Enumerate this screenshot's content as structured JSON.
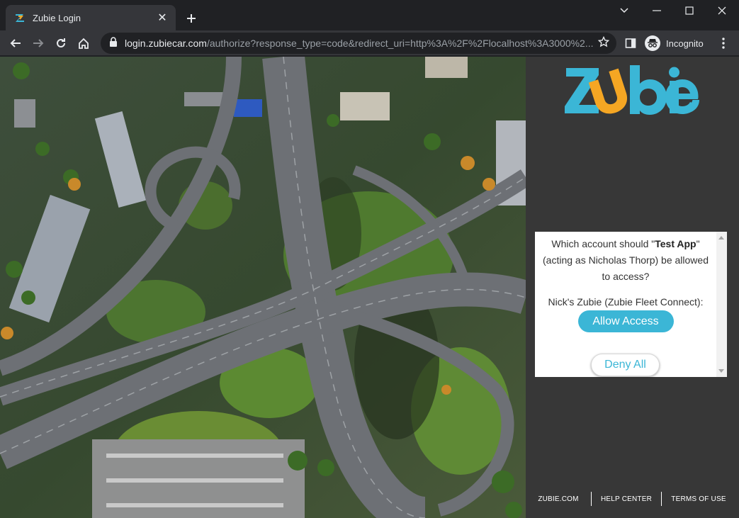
{
  "browser": {
    "tab_title": "Zubie Login",
    "url_host": "login.zubiecar.com",
    "url_path": "/authorize?response_type=code&redirect_uri=http%3A%2F%2Flocalhost%3A3000%2...",
    "profile_label": "Incognito"
  },
  "brand": {
    "logo_text": "Zubie",
    "colors": {
      "logo_blue": "#3bb6d6",
      "logo_orange": "#f5a623",
      "panel_bg": "#373737"
    }
  },
  "auth": {
    "question_prefix": "Which account should \"",
    "app_name": "Test App",
    "question_suffix": "\" (acting as Nicholas Thorp) be allowed to access?",
    "account_label": "Nick's Zubie (Zubie Fleet Connect):",
    "allow_label": "Allow Access",
    "deny_label": "Deny All"
  },
  "footer": {
    "links": [
      "ZUBIE.COM",
      "HELP CENTER",
      "TERMS OF USE"
    ]
  }
}
